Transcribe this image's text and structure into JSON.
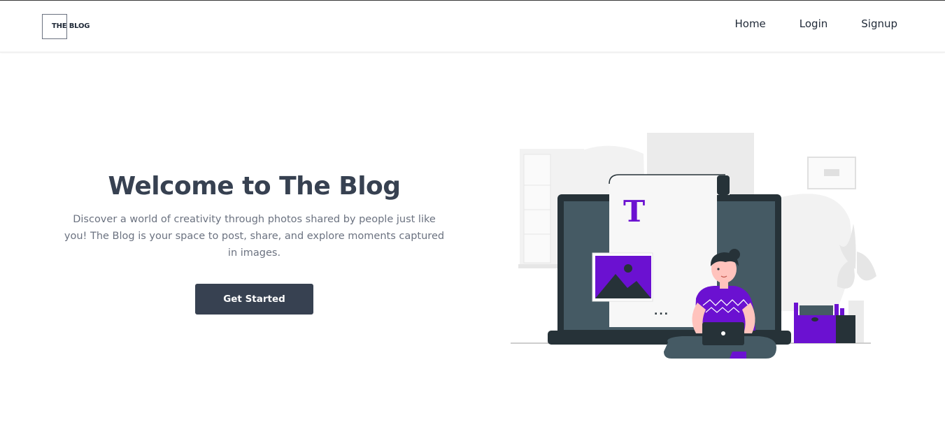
{
  "brand": {
    "logo_text": "THE BLOG"
  },
  "nav": {
    "links": [
      "Home",
      "Login",
      "Signup"
    ]
  },
  "hero": {
    "title": "Welcome to The Blog",
    "description": "Discover a world of creativity through photos shared by people just like you! The Blog is your space to post, share, and explore moments captured in images.",
    "cta_label": "Get Started"
  },
  "illustration": {
    "doc_letter": "T",
    "doc_dots": "...",
    "colors": {
      "accent": "#6b11d1",
      "dark": "#263238",
      "screen": "#455a64",
      "light_gray": "#ebebeb",
      "paper": "#f7f7f7"
    }
  },
  "colors": {
    "primary_button": "#374151",
    "heading": "#374151",
    "body_text": "#6b7280"
  }
}
